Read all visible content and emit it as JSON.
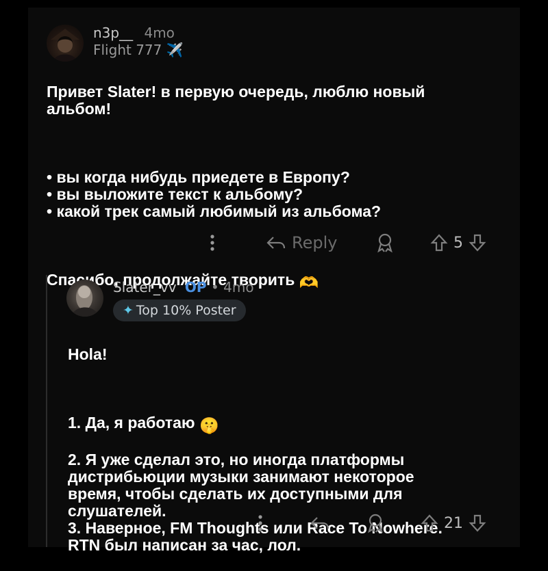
{
  "comments": [
    {
      "username": "n3p__",
      "age": "4mo",
      "flair": "Flight 777 ✈️",
      "paragraphs": [
        "Привет Slater! в первую очередь, люблю новый\nальбом!",
        "• вы когда нибудь приедете в Европу?\n• вы выложите текст к альбому?\n• какой трек самый любимый из альбома?",
        "Спасибо, продолжайте творить"
      ],
      "emoji": "🫶",
      "reply_label": "Reply",
      "score": "5"
    },
    {
      "username": "Slater_vv",
      "op_label": "OP",
      "separator": "•",
      "age": "4mo",
      "badge": "Top 10% Poster",
      "paragraphs": [
        "Hola!",
        "1. Да, я работаю",
        "2. Я уже сделал это, но иногда платформы\nдистрибьюции музыки занимают некоторое\nвремя, чтобы сделать их доступными для\nслушателей.\n3. Наверное, FM Thoughts или Race To Nowhere.\nRTN был написан за час, лол."
      ],
      "emoji": "🤫",
      "score": "21"
    }
  ]
}
